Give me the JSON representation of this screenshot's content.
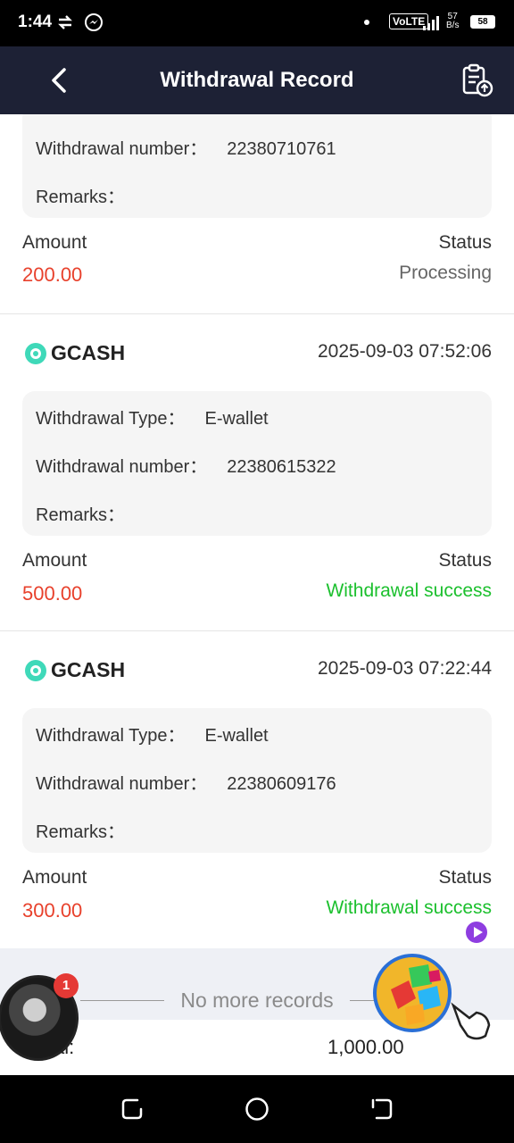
{
  "status_bar": {
    "time": "1:44",
    "network": "VoLTE",
    "speed_value": "57",
    "speed_unit": "B/s",
    "battery": "58"
  },
  "header": {
    "title": "Withdrawal Record"
  },
  "labels": {
    "withdrawal_type": "Withdrawal Type：",
    "withdrawal_number": "Withdrawal number：",
    "remarks": "Remarks：",
    "amount": "Amount",
    "status": "Status"
  },
  "records": [
    {
      "method": "",
      "datetime": "",
      "type": "",
      "number": "22380710761",
      "remarks": "",
      "amount": "200.00",
      "status": "Processing",
      "status_color": "#666666"
    },
    {
      "method": "GCASH",
      "datetime": "2025-09-03 07:52:06",
      "type": "E-wallet",
      "number": "22380615322",
      "remarks": "",
      "amount": "500.00",
      "status": "Withdrawal success",
      "status_color": "#1cc02e"
    },
    {
      "method": "GCASH",
      "datetime": "2025-09-03 07:22:44",
      "type": "E-wallet",
      "number": "22380609176",
      "remarks": "",
      "amount": "300.00",
      "status": "Withdrawal success",
      "status_color": "#1cc02e"
    }
  ],
  "footer": {
    "no_more": "No more records",
    "total_label": "al:",
    "total_value": "1,000.00"
  },
  "overlay": {
    "badge_count": "1"
  },
  "colors": {
    "header_bg": "#1d2135",
    "amount": "#e8412c",
    "success": "#1cc02e",
    "gcash": "#3fd9b9"
  }
}
